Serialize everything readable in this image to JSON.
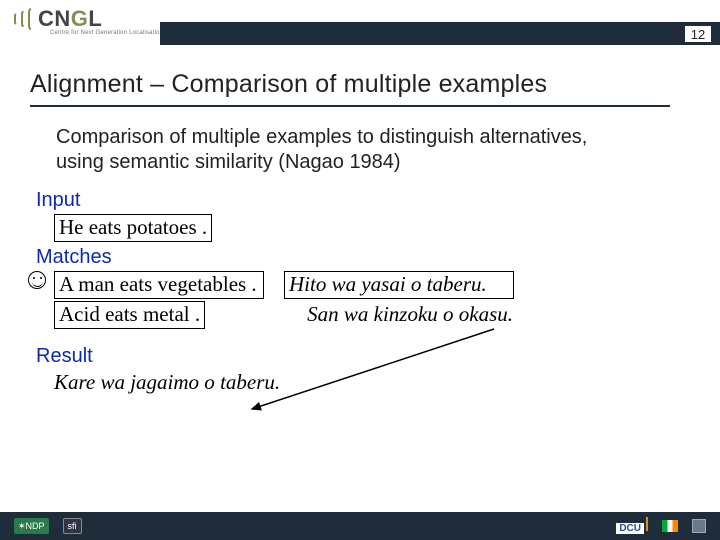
{
  "header": {
    "logo_text_1": "CN",
    "logo_text_2": "G",
    "logo_text_3": "L",
    "logo_sub": "Centre for Next Generation Localisation",
    "page_number": "12"
  },
  "title": "Alignment – Comparison of multiple examples",
  "description": "Comparison of multiple examples to distinguish alternatives, using semantic similarity (Nagao 1984)",
  "sections": {
    "input_label": "Input",
    "input_sentence": "He eats potatoes .",
    "matches_label": "Matches",
    "match1_src": "A man eats  vegetables  .",
    "match1_tgt": "Hito wa yasai o taberu.",
    "match2_src": "Acid eats metal  .",
    "match2_tgt": "San wa kinzoku o okasu.",
    "result_label": "Result",
    "result_sentence_1": "Kare wa jagaimo o ",
    "result_sentence_2": "taberu."
  },
  "footer": {
    "left": [
      "NDP",
      "sfi"
    ],
    "right": [
      "DCU",
      "flag",
      "TCD"
    ]
  }
}
